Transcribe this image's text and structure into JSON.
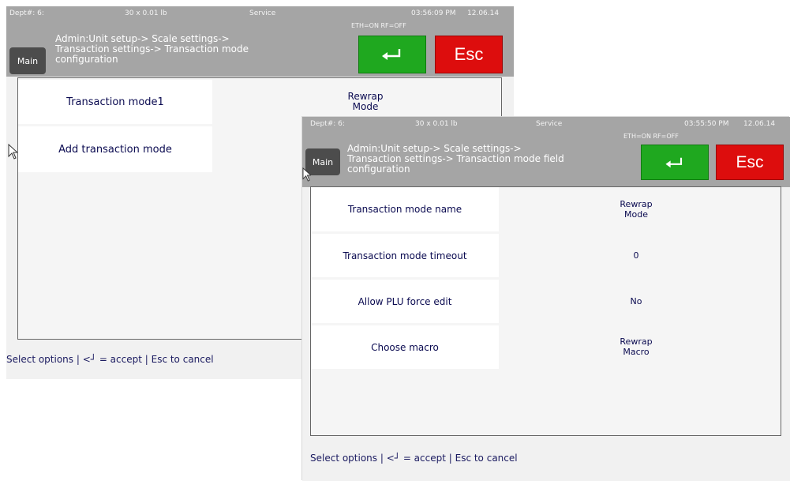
{
  "window1": {
    "status": {
      "dept": "Dept#: 6:",
      "weight": "30 x 0.01 lb",
      "mode": "Service",
      "time": "03:56:09 PM",
      "date": "12.06.14",
      "network": "ETH=ON  RF=OFF"
    },
    "main_label": "Main",
    "breadcrumb": [
      "Admin:Unit setup-> Scale settings->",
      "Transaction settings-> Transaction mode",
      "configuration"
    ],
    "esc_label": "Esc",
    "items": [
      {
        "label": "Transaction mode1",
        "value": "Rewrap\nMode"
      },
      {
        "label": "Add transaction mode",
        "value": ""
      }
    ],
    "footer": {
      "prefix": "Select options | <",
      "suffix": " = accept | Esc to cancel"
    }
  },
  "window2": {
    "status": {
      "dept": "Dept#: 6:",
      "weight": "30 x 0.01 lb",
      "mode": "Service",
      "time": "03:55:50 PM",
      "date": "12.06.14",
      "network": "ETH=ON  RF=OFF"
    },
    "main_label": "Main",
    "breadcrumb": [
      "Admin:Unit setup-> Scale settings->",
      "Transaction settings-> Transaction mode field",
      "configuration"
    ],
    "esc_label": "Esc",
    "rows": [
      {
        "label": "Transaction mode name",
        "value": "Rewrap\nMode"
      },
      {
        "label": "Transaction mode timeout",
        "value": "0"
      },
      {
        "label": "Allow PLU force edit",
        "value": "No"
      },
      {
        "label": "Choose macro",
        "value": "Rewrap\nMacro"
      }
    ],
    "footer": {
      "prefix": "Select options | <",
      "suffix": " = accept | Esc to cancel"
    }
  },
  "icons": {
    "accept": "enter-return-icon",
    "cursor": "mouse-pointer-icon"
  },
  "colors": {
    "accept": "#1fa81f",
    "escape": "#dd0d0d",
    "header": "#a5a5a5",
    "main_button": "#4c4c4c",
    "text": "#0a0a50"
  }
}
